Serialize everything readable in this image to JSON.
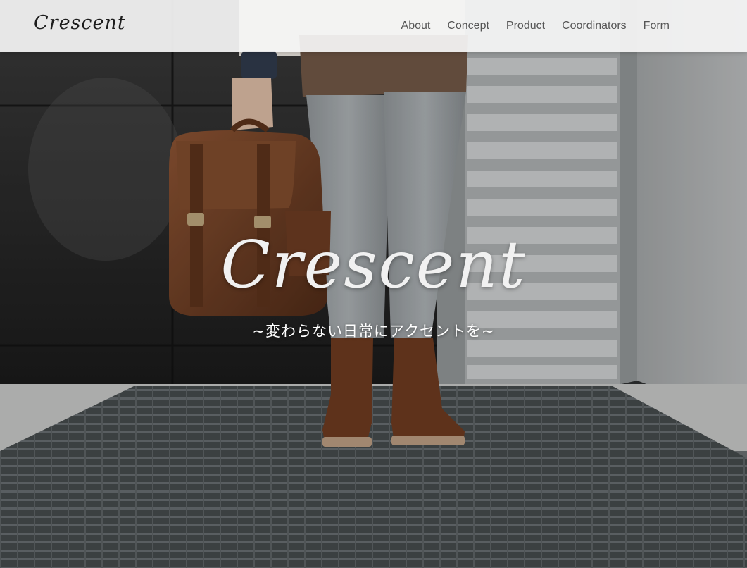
{
  "header": {
    "logo": "Crescent",
    "nav": [
      {
        "label": "About"
      },
      {
        "label": "Concept"
      },
      {
        "label": "Product"
      },
      {
        "label": "Coordinators"
      },
      {
        "label": "Form"
      }
    ]
  },
  "hero": {
    "title": "Crescent",
    "subtitle": "~変わらない日常にアクセントを~",
    "image": "hero-photo-man-with-leather-backpack"
  },
  "colors": {
    "header_bg": "#f5f5f5",
    "nav_text": "#555555",
    "logo_text": "#1d1d1d",
    "hero_text": "#f1f1f1"
  }
}
